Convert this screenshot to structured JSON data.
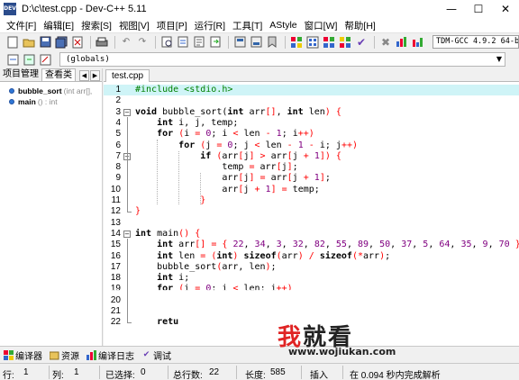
{
  "window": {
    "title": "D:\\c\\test.cpp - Dev-C++ 5.11",
    "app_icon_text": "DEV",
    "minimize_glyph": "—",
    "maximize_glyph": "☐",
    "close_glyph": "✕"
  },
  "menu": {
    "items": [
      "文件[F]",
      "编辑[E]",
      "搜索[S]",
      "视图[V]",
      "项目[P]",
      "运行[R]",
      "工具[T]",
      "AStyle",
      "窗口[W]",
      "帮助[H]"
    ]
  },
  "toolbar": {
    "icons": [
      "new-file-icon",
      "open-icon",
      "save-icon",
      "save-all-icon",
      "close-file-icon",
      "print-icon",
      "undo-icon",
      "redo-icon",
      "search-icon",
      "replace-icon",
      "find-next-icon",
      "goto-icon",
      "indent-icon",
      "unindent-icon",
      "toggle-bookmark-icon",
      "compile-icon",
      "run-icon",
      "compile-run-icon",
      "rebuild-icon",
      "check-icon",
      "stop-icon",
      "profile-icon",
      "chart-icon"
    ],
    "compiler": "TDM-GCC 4.9.2 64-bit"
  },
  "toolbar2": {
    "scope_value": "(globals)"
  },
  "left_panel": {
    "tabs": [
      "项目管理",
      "查看类"
    ],
    "active_tab": 1,
    "items": [
      {
        "name": "bubble_sort",
        "signature": "(int arr[],"
      },
      {
        "name": "main",
        "signature": "() : int"
      }
    ]
  },
  "editor": {
    "file_tab": "test.cpp",
    "current_line": 1,
    "lines": [
      {
        "n": 1,
        "tokens": [
          [
            "pp",
            "#include <stdio.h>"
          ]
        ]
      },
      {
        "n": 2,
        "tokens": []
      },
      {
        "n": 3,
        "tokens": [
          [
            "k",
            "void"
          ],
          [
            "s",
            " bubble_sort("
          ],
          [
            "k",
            "int"
          ],
          [
            "s",
            " arr"
          ],
          [
            "p",
            "[]"
          ],
          [
            "s",
            ", "
          ],
          [
            "k",
            "int"
          ],
          [
            "s",
            " len"
          ],
          [
            "p",
            ")"
          ],
          [
            "s",
            " "
          ],
          [
            "p",
            "{"
          ]
        ]
      },
      {
        "n": 4,
        "tokens": [
          [
            "s",
            "    "
          ],
          [
            "k",
            "int"
          ],
          [
            "s",
            " i, j, temp;"
          ]
        ]
      },
      {
        "n": 5,
        "tokens": [
          [
            "s",
            "    "
          ],
          [
            "k",
            "for"
          ],
          [
            "s",
            " "
          ],
          [
            "p",
            "("
          ],
          [
            "s",
            "i "
          ],
          [
            "p",
            "="
          ],
          [
            "s",
            " "
          ],
          [
            "n",
            "0"
          ],
          [
            "s",
            "; i "
          ],
          [
            "p",
            "<"
          ],
          [
            "s",
            " len "
          ],
          [
            "p",
            "-"
          ],
          [
            "s",
            " "
          ],
          [
            "n",
            "1"
          ],
          [
            "s",
            "; i"
          ],
          [
            "p",
            "++)"
          ]
        ]
      },
      {
        "n": 6,
        "tokens": [
          [
            "s",
            "        "
          ],
          [
            "k",
            "for"
          ],
          [
            "s",
            " "
          ],
          [
            "p",
            "("
          ],
          [
            "s",
            "j "
          ],
          [
            "p",
            "="
          ],
          [
            "s",
            " "
          ],
          [
            "n",
            "0"
          ],
          [
            "s",
            "; j "
          ],
          [
            "p",
            "<"
          ],
          [
            "s",
            " len "
          ],
          [
            "p",
            "-"
          ],
          [
            "s",
            " "
          ],
          [
            "n",
            "1"
          ],
          [
            "s",
            " "
          ],
          [
            "p",
            "-"
          ],
          [
            "s",
            " i; j"
          ],
          [
            "p",
            "++)"
          ]
        ]
      },
      {
        "n": 7,
        "tokens": [
          [
            "s",
            "            "
          ],
          [
            "k",
            "if"
          ],
          [
            "s",
            " "
          ],
          [
            "p",
            "("
          ],
          [
            "s",
            "arr"
          ],
          [
            "p",
            "["
          ],
          [
            "s",
            "j"
          ],
          [
            "p",
            "]"
          ],
          [
            "s",
            " "
          ],
          [
            "p",
            ">"
          ],
          [
            "s",
            " arr"
          ],
          [
            "p",
            "["
          ],
          [
            "s",
            "j "
          ],
          [
            "p",
            "+"
          ],
          [
            "s",
            " "
          ],
          [
            "n",
            "1"
          ],
          [
            "p",
            "])"
          ],
          [
            "s",
            " "
          ],
          [
            "p",
            "{"
          ]
        ]
      },
      {
        "n": 8,
        "tokens": [
          [
            "s",
            "                temp "
          ],
          [
            "p",
            "="
          ],
          [
            "s",
            " arr"
          ],
          [
            "p",
            "["
          ],
          [
            "s",
            "j"
          ],
          [
            "p",
            "]"
          ],
          [
            "s",
            ";"
          ]
        ]
      },
      {
        "n": 9,
        "tokens": [
          [
            "s",
            "                arr"
          ],
          [
            "p",
            "["
          ],
          [
            "s",
            "j"
          ],
          [
            "p",
            "]"
          ],
          [
            "s",
            " "
          ],
          [
            "p",
            "="
          ],
          [
            "s",
            " arr"
          ],
          [
            "p",
            "["
          ],
          [
            "s",
            "j "
          ],
          [
            "p",
            "+"
          ],
          [
            "s",
            " "
          ],
          [
            "n",
            "1"
          ],
          [
            "p",
            "]"
          ],
          [
            "s",
            ";"
          ]
        ]
      },
      {
        "n": 10,
        "tokens": [
          [
            "s",
            "                arr"
          ],
          [
            "p",
            "["
          ],
          [
            "s",
            "j "
          ],
          [
            "p",
            "+"
          ],
          [
            "s",
            " "
          ],
          [
            "n",
            "1"
          ],
          [
            "p",
            "]"
          ],
          [
            "s",
            " "
          ],
          [
            "p",
            "="
          ],
          [
            "s",
            " temp;"
          ]
        ]
      },
      {
        "n": 11,
        "tokens": [
          [
            "s",
            "            "
          ],
          [
            "p",
            "}"
          ]
        ]
      },
      {
        "n": 12,
        "tokens": [
          [
            "p",
            "}"
          ]
        ]
      },
      {
        "n": 13,
        "tokens": []
      },
      {
        "n": 14,
        "tokens": [
          [
            "k",
            "int"
          ],
          [
            "s",
            " main"
          ],
          [
            "p",
            "()"
          ],
          [
            "s",
            " "
          ],
          [
            "p",
            "{"
          ]
        ]
      },
      {
        "n": 15,
        "tokens": [
          [
            "s",
            "    "
          ],
          [
            "k",
            "int"
          ],
          [
            "s",
            " arr"
          ],
          [
            "p",
            "[]"
          ],
          [
            "s",
            " "
          ],
          [
            "p",
            "="
          ],
          [
            "s",
            " "
          ],
          [
            "p",
            "{"
          ],
          [
            "s",
            " "
          ],
          [
            "n",
            "22"
          ],
          [
            "s",
            ", "
          ],
          [
            "n",
            "34"
          ],
          [
            "s",
            ", "
          ],
          [
            "n",
            "3"
          ],
          [
            "s",
            ", "
          ],
          [
            "n",
            "32"
          ],
          [
            "s",
            ", "
          ],
          [
            "n",
            "82"
          ],
          [
            "s",
            ", "
          ],
          [
            "n",
            "55"
          ],
          [
            "s",
            ", "
          ],
          [
            "n",
            "89"
          ],
          [
            "s",
            ", "
          ],
          [
            "n",
            "50"
          ],
          [
            "s",
            ", "
          ],
          [
            "n",
            "37"
          ],
          [
            "s",
            ", "
          ],
          [
            "n",
            "5"
          ],
          [
            "s",
            ", "
          ],
          [
            "n",
            "64"
          ],
          [
            "s",
            ", "
          ],
          [
            "n",
            "35"
          ],
          [
            "s",
            ", "
          ],
          [
            "n",
            "9"
          ],
          [
            "s",
            ", "
          ],
          [
            "n",
            "70"
          ],
          [
            "s",
            " "
          ],
          [
            "p",
            "}"
          ],
          [
            "s",
            ";"
          ]
        ]
      },
      {
        "n": 16,
        "tokens": [
          [
            "s",
            "    "
          ],
          [
            "k",
            "int"
          ],
          [
            "s",
            " len "
          ],
          [
            "p",
            "="
          ],
          [
            "s",
            " "
          ],
          [
            "p",
            "("
          ],
          [
            "k",
            "int"
          ],
          [
            "p",
            ")"
          ],
          [
            "s",
            " "
          ],
          [
            "k",
            "sizeof"
          ],
          [
            "p",
            "("
          ],
          [
            "s",
            "arr"
          ],
          [
            "p",
            ")"
          ],
          [
            "s",
            " "
          ],
          [
            "p",
            "/"
          ],
          [
            "s",
            " "
          ],
          [
            "k",
            "sizeof"
          ],
          [
            "p",
            "(*"
          ],
          [
            "s",
            "arr"
          ],
          [
            "p",
            ")"
          ],
          [
            "s",
            ";"
          ]
        ]
      },
      {
        "n": 17,
        "tokens": [
          [
            "s",
            "    bubble_sort"
          ],
          [
            "p",
            "("
          ],
          [
            "s",
            "arr, len"
          ],
          [
            "p",
            ")"
          ],
          [
            "s",
            ";"
          ]
        ]
      },
      {
        "n": 18,
        "tokens": [
          [
            "s",
            "    "
          ],
          [
            "k",
            "int"
          ],
          [
            "s",
            " i;"
          ]
        ]
      },
      {
        "n": 19,
        "tokens": [
          [
            "s",
            "    "
          ],
          [
            "k",
            "for"
          ],
          [
            "s",
            " "
          ],
          [
            "p",
            "("
          ],
          [
            "s",
            "i "
          ],
          [
            "p",
            "="
          ],
          [
            "s",
            " "
          ],
          [
            "n",
            "0"
          ],
          [
            "s",
            "; i "
          ],
          [
            "p",
            "<"
          ],
          [
            "s",
            " len; i"
          ],
          [
            "p",
            "++)"
          ]
        ]
      },
      {
        "n": 20,
        "tokens": []
      },
      {
        "n": 21,
        "tokens": []
      },
      {
        "n": 22,
        "tokens": [
          [
            "s",
            "    "
          ],
          [
            "k",
            "retu"
          ]
        ]
      }
    ]
  },
  "bottom_tabs": [
    {
      "icon": "compiler-icon",
      "label": "编译器"
    },
    {
      "icon": "resources-icon",
      "label": "资源"
    },
    {
      "icon": "compile-log-icon",
      "label": "编译日志"
    },
    {
      "icon": "debug-icon",
      "label": "调试"
    }
  ],
  "status": {
    "row_label": "行:",
    "row": "1",
    "col_label": "列:",
    "col": "1",
    "selected_label": "已选择:",
    "selected": "0",
    "total_label": "总行数:",
    "total": "22",
    "length_label": "长度:",
    "length": "585",
    "mode": "插入",
    "message": "在 0.094 秒内完成解析"
  },
  "watermark": {
    "char1": "我",
    "rest": "就看",
    "url": "www.wojiukan.com"
  }
}
